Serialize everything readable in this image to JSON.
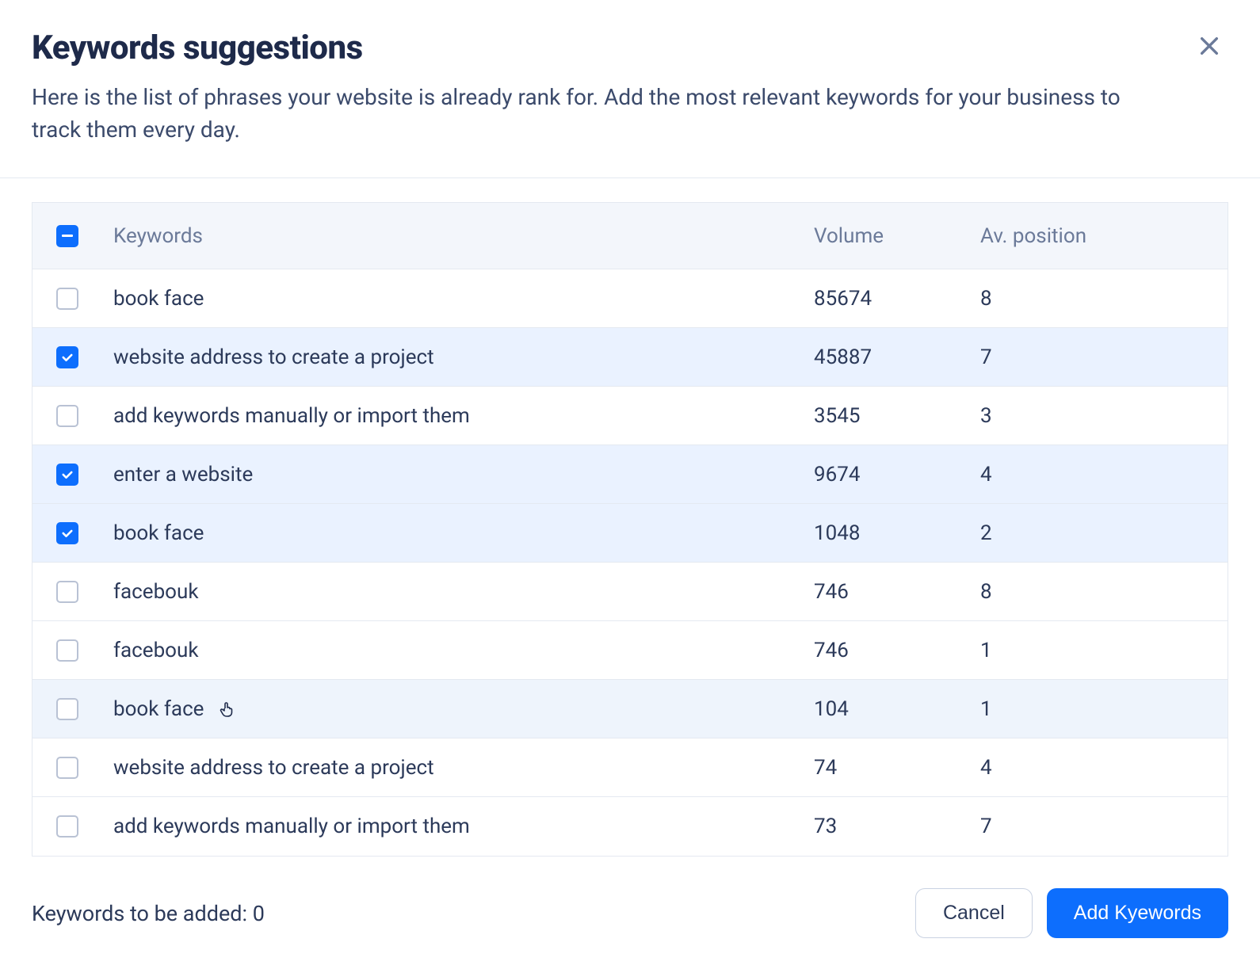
{
  "modal": {
    "title": "Keywords suggestions",
    "subtitle": "Here is the list of phrases your website is already rank for. Add the most relevant keywords for your business to track them every day."
  },
  "table": {
    "headers": {
      "keywords": "Keywords",
      "volume": "Volume",
      "position": "Av. position"
    },
    "select_all_state": "indeterminate",
    "rows": [
      {
        "keyword": "book face",
        "volume": "85674",
        "position": "8",
        "checked": false,
        "hover": false
      },
      {
        "keyword": "website address to create a project",
        "volume": "45887",
        "position": "7",
        "checked": true,
        "hover": false
      },
      {
        "keyword": "add keywords manually or import them",
        "volume": "3545",
        "position": "3",
        "checked": false,
        "hover": false
      },
      {
        "keyword": "enter a website",
        "volume": "9674",
        "position": "4",
        "checked": true,
        "hover": false
      },
      {
        "keyword": "book face",
        "volume": "1048",
        "position": "2",
        "checked": true,
        "hover": false
      },
      {
        "keyword": "facebouk",
        "volume": "746",
        "position": "8",
        "checked": false,
        "hover": false
      },
      {
        "keyword": "facebouk",
        "volume": "746",
        "position": "1",
        "checked": false,
        "hover": false
      },
      {
        "keyword": "book face",
        "volume": "104",
        "position": "1",
        "checked": false,
        "hover": true
      },
      {
        "keyword": "website address to create a project",
        "volume": "74",
        "position": "4",
        "checked": false,
        "hover": false
      },
      {
        "keyword": "add keywords manually or import them",
        "volume": "73",
        "position": "7",
        "checked": false,
        "hover": false
      }
    ]
  },
  "footer": {
    "counter_label": "Keywords to be added: ",
    "counter_value": "0",
    "cancel_label": "Cancel",
    "add_label": "Add Kyewords"
  }
}
